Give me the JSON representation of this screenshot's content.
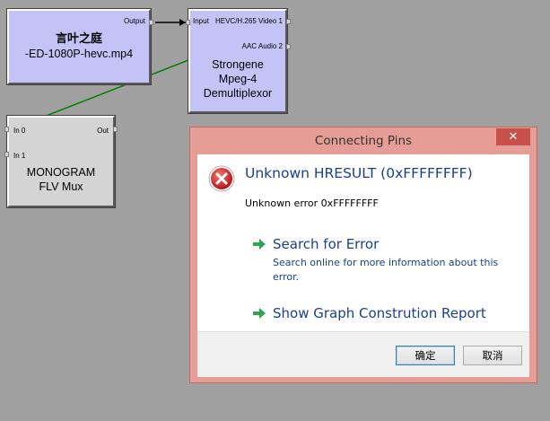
{
  "graph": {
    "source_filter": {
      "title_line1": "言叶之庭",
      "title_line2": "-ED-1080P-hevc.mp4",
      "output_pin": "Output"
    },
    "demux_filter": {
      "title_line1": "Strongene",
      "title_line2": "Mpeg-4",
      "title_line3": "Demultiplexor",
      "input_pin": "Input",
      "video_pin": "HEVC/H.265 Video 1",
      "audio_pin": "AAC Audio 2"
    },
    "mux_filter": {
      "title_line1": "MONOGRAM",
      "title_line2": "FLV Mux",
      "in0_pin": "In 0",
      "in1_pin": "In 1",
      "out_pin": "Out"
    },
    "colors": {
      "canvas": "#a0a0a0",
      "filter_blue": "#c3c3f8",
      "filter_gray": "#d4d4d4",
      "connect_line": "#008000"
    }
  },
  "dialog": {
    "title": "Connecting Pins",
    "close_label": "✕",
    "icon": "error-icon",
    "main_instruction": "Unknown HRESULT (0xFFFFFFFF)",
    "content": "Unknown error 0xFFFFFFFF",
    "commands": [
      {
        "icon": "green-arrow-icon",
        "title": "Search for Error",
        "description": "Search online for more information about this error."
      },
      {
        "icon": "green-arrow-icon",
        "title": "Show Graph Constrution Report",
        "description": ""
      }
    ],
    "ok_label": "确定",
    "cancel_label": "取消"
  }
}
